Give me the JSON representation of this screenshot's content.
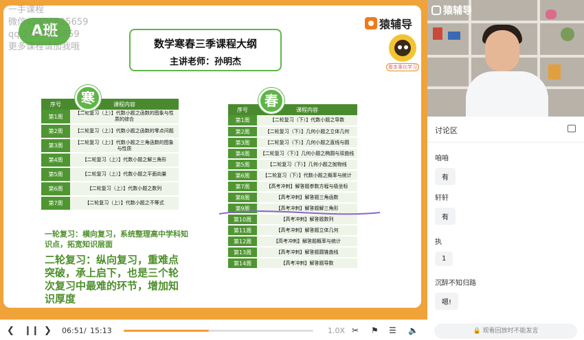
{
  "watermark": {
    "lines": [
      "一手课程",
      "微信x2404825659",
      "qq:2404825659",
      "更多课程请加我哦"
    ]
  },
  "slide": {
    "class_badge": "A班",
    "brand": "猿辅导",
    "mascot_tag": "看本事比学习",
    "title": "数学寒春三季课程大纲",
    "subtitle": "主讲老师：孙明杰",
    "winter_label": "寒",
    "spring_label": "春",
    "winter_table": {
      "headers": [
        "序号",
        "课程内容"
      ],
      "rows": [
        [
          "第1周",
          "【二轮复习（上）】代数小题之函数的图象与性质的综合"
        ],
        [
          "第2周",
          "【二轮复习（上）】代数小题之函数的零点问题"
        ],
        [
          "第3周",
          "【二轮复习（上）】代数小题之三角函数的图象与性质"
        ],
        [
          "第4周",
          "【二轮复习（上）】代数小题之解三角形"
        ],
        [
          "第5周",
          "【二轮复习（上）】代数小题之平面向量"
        ],
        [
          "第6周",
          "【二轮复习（上）】代数小题之数列"
        ],
        [
          "第7周",
          "【二轮复习（上）】代数小题之不等式"
        ]
      ]
    },
    "spring_table": {
      "headers": [
        "序号",
        "课程内容"
      ],
      "rows": [
        [
          "第1周",
          "【二轮复习（下）】代数小题之导数"
        ],
        [
          "第2周",
          "【二轮复习（下）】几何小题之立体几何"
        ],
        [
          "第3周",
          "【二轮复习（下）】几何小题之直线与圆"
        ],
        [
          "第4周",
          "【二轮复习（下）】几何小题之椭圆与双曲线"
        ],
        [
          "第5周",
          "【二轮复习（下）】几何小题之抛物线"
        ],
        [
          "第6周",
          "【二轮复习（下）】代数小题之概率与统计"
        ],
        [
          "第7周",
          "【高考冲刺】解答题参数方程与极坐标"
        ],
        [
          "第8周",
          "【高考冲刺】解答题三角函数"
        ],
        [
          "第9周",
          "【高考冲刺】解答题解三角形"
        ],
        [
          "第10周",
          "【高考冲刺】解答题数列"
        ],
        [
          "第11周",
          "【高考冲刺】解答题立体几何"
        ],
        [
          "第12周",
          "【高考冲刺】解答题概率与统计"
        ],
        [
          "第13周",
          "【高考冲刺】解答题圆锥曲线"
        ],
        [
          "第14周",
          "【高考冲刺】解答题导数"
        ]
      ]
    },
    "note1": "一轮复习：横向复习，系统整理高中学科知识点，拓宽知识层面",
    "note2": "二轮复习：纵向复习，重难点突破，承上启下，也是三个轮次复习中最难的环节，增加知识厚度"
  },
  "video": {
    "logo": "猿辅导"
  },
  "chat": {
    "title": "讨论区",
    "messages": [
      {
        "user": "咱咱",
        "text": "有"
      },
      {
        "user": "轩轩",
        "text": "有"
      },
      {
        "user": "执",
        "text": "1"
      },
      {
        "user": "沉醉不知归路",
        "text": "嗯!"
      }
    ],
    "input_placeholder": "观看回放时不能发言"
  },
  "player": {
    "current_time": "06:51",
    "separator": "/",
    "total_time": "15:13",
    "progress": 0.45,
    "speed": "1.0X",
    "accent_color": "#f39c34"
  }
}
